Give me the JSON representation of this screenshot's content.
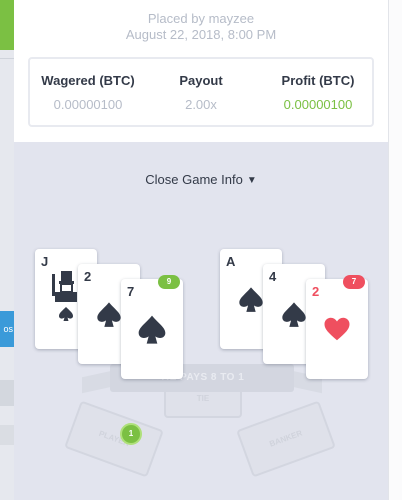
{
  "background": {
    "side_button_label": "os"
  },
  "bet_info": {
    "placed_by": "Placed by mayzee",
    "placed_at": "August 22, 2018, 8:00 PM"
  },
  "stats": {
    "wagered": {
      "label": "Wagered (BTC)",
      "value": "0.00000100"
    },
    "payout": {
      "label": "Payout",
      "value": "2.00x"
    },
    "profit": {
      "label": "Profit (BTC)",
      "value": "0.00000100"
    }
  },
  "game": {
    "toggle_label": "Close Game Info",
    "tie_banner": "TIE PAYS 8 TO 1",
    "zones": {
      "tie": "TIE",
      "player": "PLAYER",
      "banker": "BANKER"
    },
    "chip_value": "1",
    "player_hand": {
      "total": "9",
      "cards": [
        {
          "rank": "J",
          "suit": "spade"
        },
        {
          "rank": "2",
          "suit": "spade"
        },
        {
          "rank": "7",
          "suit": "spade"
        }
      ]
    },
    "banker_hand": {
      "total": "7",
      "cards": [
        {
          "rank": "A",
          "suit": "spade"
        },
        {
          "rank": "4",
          "suit": "spade"
        },
        {
          "rank": "2",
          "suit": "heart"
        }
      ]
    }
  },
  "colors": {
    "accent_green": "#7bc043",
    "accent_red": "#ef4f5f",
    "text_dark": "#333a48",
    "text_muted": "#b6bcc8"
  }
}
